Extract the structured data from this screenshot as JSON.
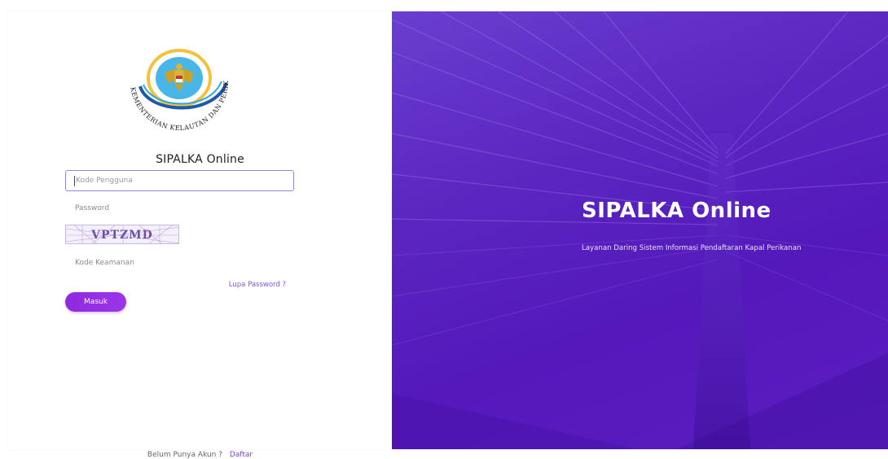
{
  "logo": {
    "ring_text": "KEMENTERIAN KELAUTAN DAN PERIKANAN",
    "icon": "garuda-emblem"
  },
  "login": {
    "title": "SIPALKA Online",
    "username_placeholder": "Kode Pengguna",
    "password_placeholder": "Password",
    "captcha_text": "VPTZMD",
    "security_code_placeholder": "Kode Keamanan",
    "forgot_password": "Lupa Password ?",
    "submit_label": "Masuk"
  },
  "register": {
    "prompt": "Belum Punya Akun ?",
    "link": "Daftar"
  },
  "hero": {
    "title": "SIPALKA Online",
    "subtitle": "Layanan Daring Sistem Informasi Pendaftaran Kapal Perikanan"
  },
  "colors": {
    "accent": "#8a2be2",
    "hero_background": "#5a1fb8",
    "link": "#7f57e0"
  }
}
